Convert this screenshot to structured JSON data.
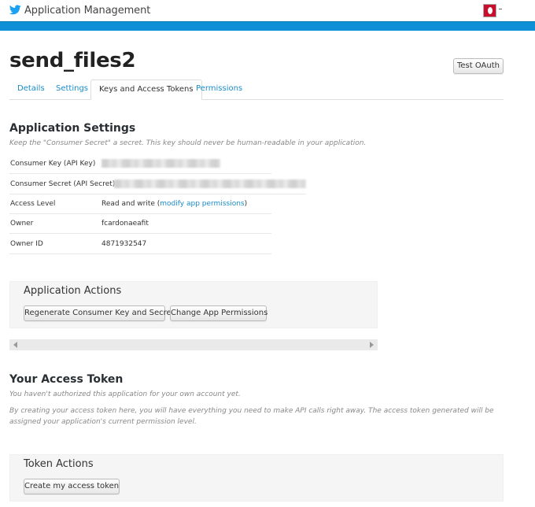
{
  "header": {
    "title": "Application Management",
    "logo_icon": "twitter-bird-icon",
    "brand_color": "#1da1f2",
    "bar_color": "#0f8fd6"
  },
  "app": {
    "name": "send_files2",
    "test_oauth_label": "Test OAuth"
  },
  "tabs": [
    {
      "label": "Details",
      "active": false
    },
    {
      "label": "Settings",
      "active": false
    },
    {
      "label": "Keys and Access Tokens",
      "active": true
    },
    {
      "label": "Permissions",
      "active": false
    }
  ],
  "application_settings": {
    "heading": "Application Settings",
    "note": "Keep the \"Consumer Secret\" a secret. This key should never be human-readable in your application.",
    "rows": {
      "consumer_key": {
        "label": "Consumer Key (API Key)",
        "value": ""
      },
      "consumer_secret": {
        "label": "Consumer Secret (API Secret)",
        "value": ""
      },
      "access_level": {
        "label": "Access Level",
        "value_prefix": "Read and write (",
        "link": "modify app permissions",
        "value_suffix": ")"
      },
      "owner": {
        "label": "Owner",
        "value": "fcardonaeafit"
      },
      "owner_id": {
        "label": "Owner ID",
        "value": "4871932547"
      }
    }
  },
  "application_actions": {
    "heading": "Application Actions",
    "regenerate_label": "Regenerate Consumer Key and Secret",
    "change_permissions_label": "Change App Permissions"
  },
  "access_token": {
    "heading": "Your Access Token",
    "note": "You haven't authorized this application for your own account yet.",
    "description": "By creating your access token here, you will have everything you need to make API calls right away. The access token generated will be assigned your application's current permission level."
  },
  "token_actions": {
    "heading": "Token Actions",
    "create_label": "Create my access token"
  }
}
